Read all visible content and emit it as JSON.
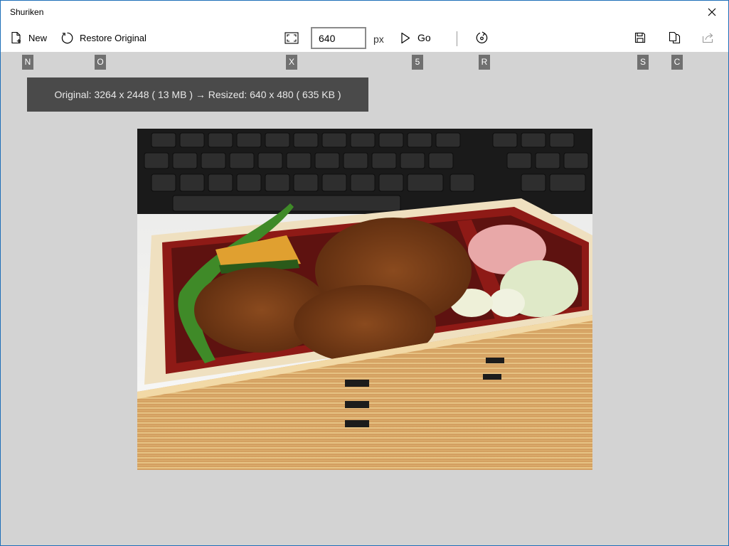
{
  "app": {
    "title": "Shuriken"
  },
  "toolbar": {
    "new_label": "New",
    "restore_label": "Restore Original",
    "size_value": "640",
    "unit_label": "px",
    "go_label": "Go"
  },
  "keytips": {
    "new": "N",
    "restore": "O",
    "fit": "X",
    "size": "5",
    "rotate": "R",
    "save": "S",
    "copy": "C"
  },
  "info": {
    "text": "Original: 3264 x 2448 ( 13 MB ) → Resized: 640 x 480 ( 635 KB )"
  },
  "icons": {
    "new": "new-document-icon",
    "restore": "restore-icon",
    "fit": "fit-to-screen-icon",
    "go": "play-icon",
    "rotate": "rotate-icon",
    "save": "save-icon",
    "copy": "copy-icon",
    "share": "share-icon",
    "close": "close-icon"
  },
  "colors": {
    "canvas": "#d3d3d3",
    "banner": "#4a4a4a",
    "keytip": "#707070",
    "window_border": "#1e6fb8"
  }
}
